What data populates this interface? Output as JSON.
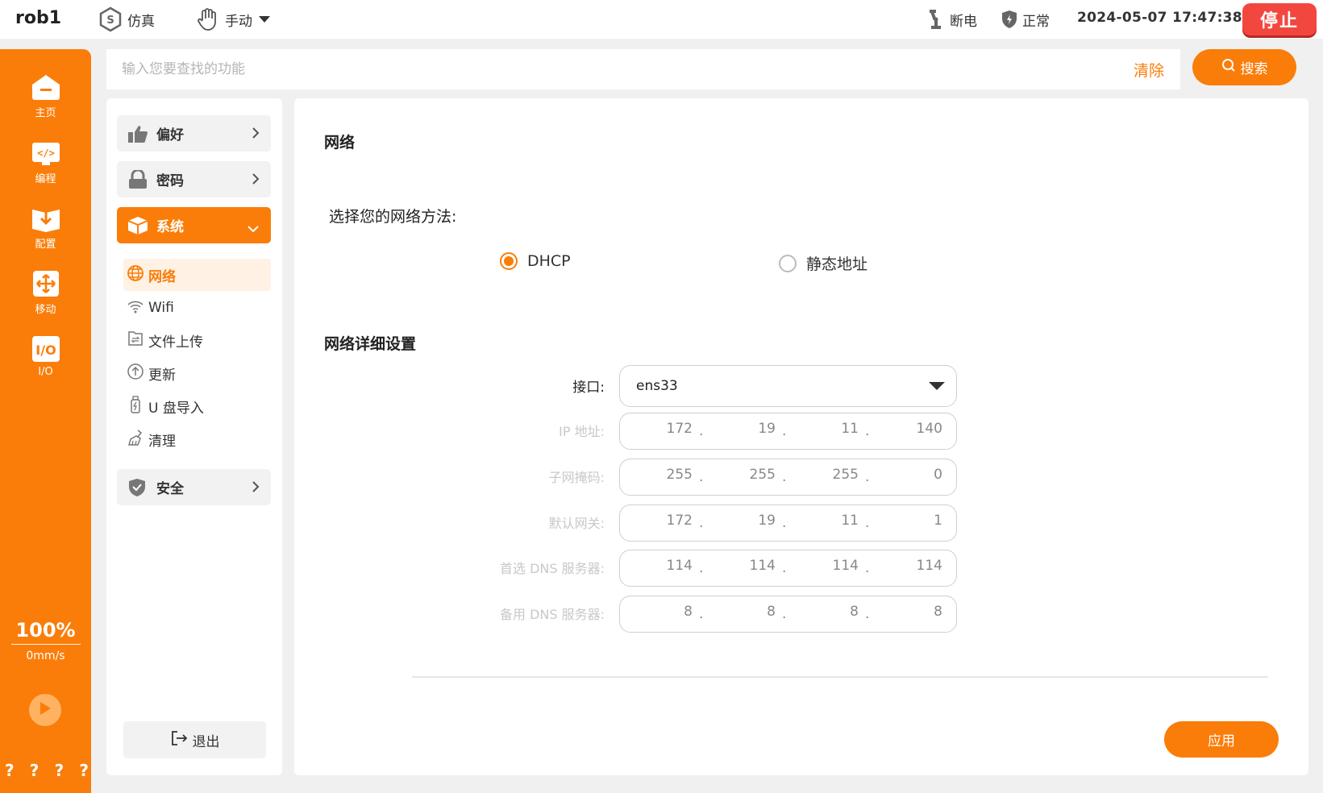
{
  "topbar": {
    "robot_name": "rob1",
    "mode_sim": "仿真",
    "mode_manual": "手动",
    "power_status": "断电",
    "safety_status": "正常",
    "datetime": "2024-05-07 17:47:38",
    "stop_label": "停止"
  },
  "leftnav": {
    "items": [
      {
        "label": "主页",
        "icon": "home-icon"
      },
      {
        "label": "编程",
        "icon": "code-icon"
      },
      {
        "label": "配置",
        "icon": "config-icon"
      },
      {
        "label": "移动",
        "icon": "move-icon"
      },
      {
        "label": "I/O",
        "icon": "io-icon"
      }
    ],
    "speed_percent": "100%",
    "speed_value": "0mm/s",
    "bottom_marks": [
      "?",
      "?",
      "?",
      "?"
    ]
  },
  "search": {
    "placeholder": "输入您要查找的功能",
    "value": "",
    "clear_label": "清除",
    "search_label": "搜索"
  },
  "menu": {
    "groups": [
      {
        "label": "偏好"
      },
      {
        "label": "密码"
      },
      {
        "label": "系统"
      },
      {
        "label": "安全"
      }
    ],
    "system_items": [
      {
        "label": "网络"
      },
      {
        "label": "Wifi"
      },
      {
        "label": "文件上传"
      },
      {
        "label": "更新"
      },
      {
        "label": "U 盘导入"
      },
      {
        "label": "清理"
      }
    ],
    "logout_label": "退出"
  },
  "network": {
    "title": "网络",
    "method_label": "选择您的网络方法:",
    "method_options": [
      "DHCP",
      "静态地址"
    ],
    "selected_method": "DHCP",
    "details_title": "网络详细设置",
    "interface_label": "接口:",
    "interface_value": "ens33",
    "fields": [
      {
        "label": "IP 地址:",
        "octets": [
          "172",
          "19",
          "11",
          "140"
        ]
      },
      {
        "label": "子网掩码:",
        "octets": [
          "255",
          "255",
          "255",
          "0"
        ]
      },
      {
        "label": "默认网关:",
        "octets": [
          "172",
          "19",
          "11",
          "1"
        ]
      },
      {
        "label": "首选 DNS 服务器:",
        "octets": [
          "114",
          "114",
          "114",
          "114"
        ]
      },
      {
        "label": "备用 DNS 服务器:",
        "octets": [
          "8",
          "8",
          "8",
          "8"
        ]
      }
    ],
    "apply_label": "应用"
  },
  "colors": {
    "accent": "#fa7d09",
    "stop": "#f2473f"
  }
}
